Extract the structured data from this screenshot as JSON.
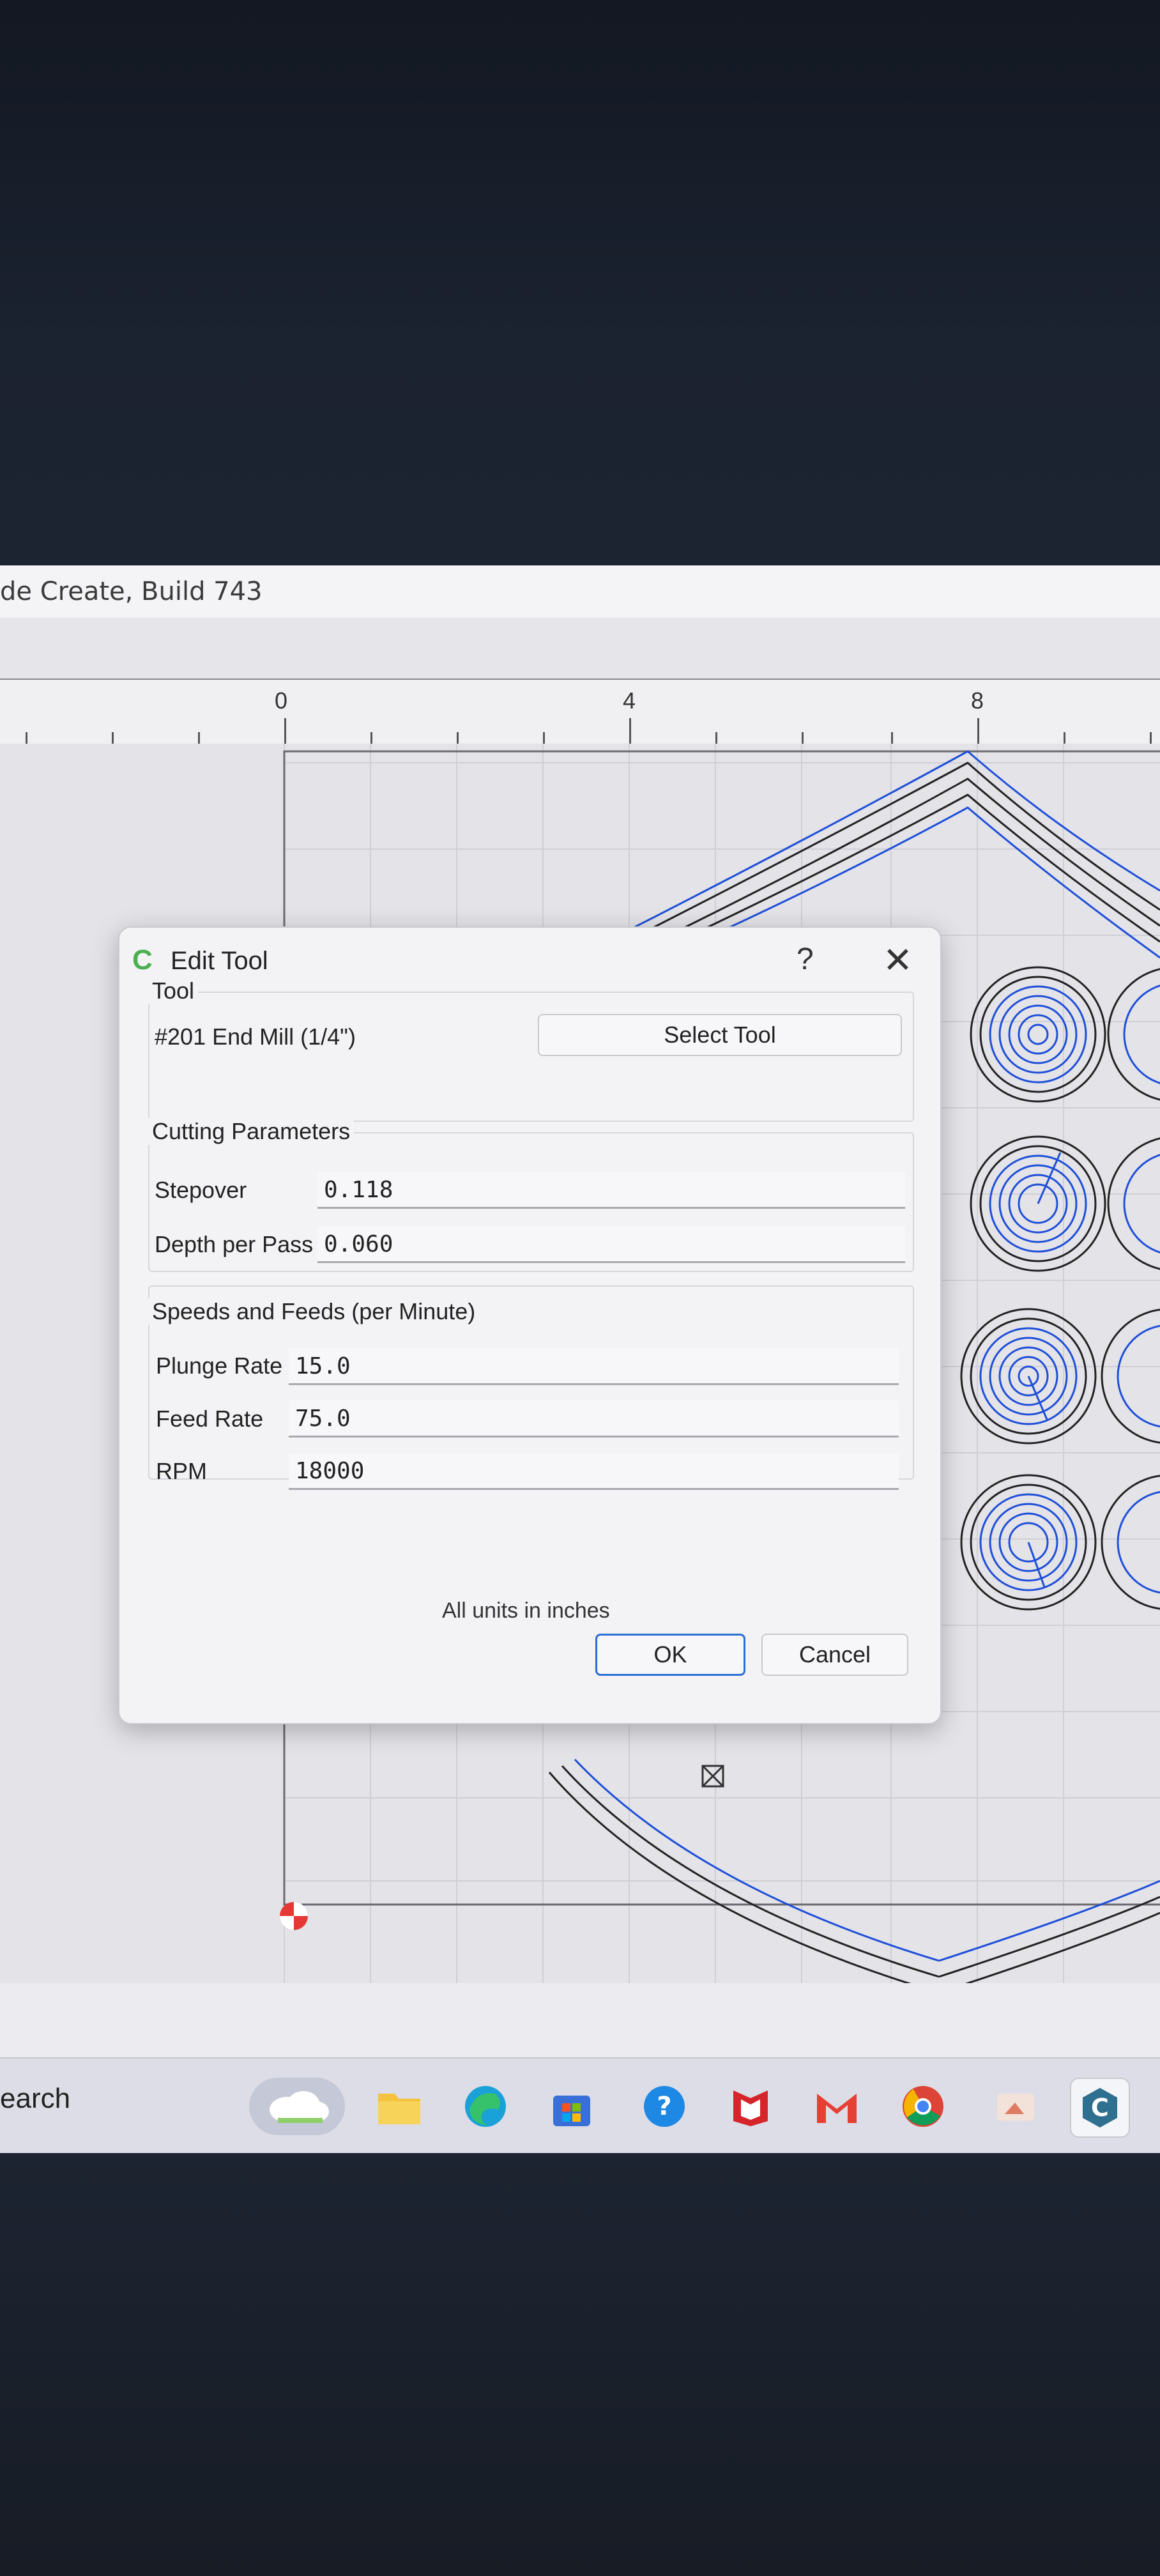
{
  "window": {
    "title": "de Create, Build 743"
  },
  "ruler": {
    "labels": [
      "0",
      "4",
      "8"
    ]
  },
  "dialog": {
    "title": "Edit Tool",
    "help_glyph": "?",
    "close_glyph": "✕",
    "tool_group": {
      "label": "Tool",
      "tool_name": "#201 End Mill (1/4\")",
      "select_button": "Select Tool"
    },
    "cutting": {
      "label": "Cutting Parameters",
      "stepover_label": "Stepover",
      "stepover_value": "0.118",
      "depth_label": "Depth per Pass",
      "depth_value": "0.060"
    },
    "speeds": {
      "label": "Speeds and Feeds (per Minute)",
      "plunge_label": "Plunge Rate",
      "plunge_value": "15.0",
      "feed_label": "Feed Rate",
      "feed_value": "75.0",
      "rpm_label": "RPM",
      "rpm_value": "18000"
    },
    "units_note": "All units in inches",
    "ok_button": "OK",
    "cancel_button": "Cancel"
  },
  "taskbar": {
    "search_text": "earch",
    "icons": [
      "weather-icon",
      "file-explorer-icon",
      "edge-icon",
      "store-icon",
      "help-icon",
      "mcafee-icon",
      "gmail-icon",
      "chrome-icon",
      "photos-icon",
      "carbide-create-icon"
    ]
  },
  "colors": {
    "accent": "#2a6fd6",
    "toolpath": "#1f4fd8",
    "vector": "#222222"
  }
}
